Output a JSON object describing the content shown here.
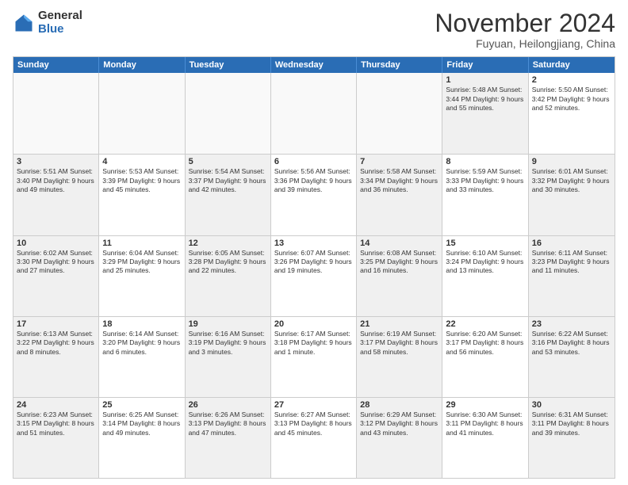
{
  "logo": {
    "general": "General",
    "blue": "Blue"
  },
  "title": {
    "month": "November 2024",
    "location": "Fuyuan, Heilongjiang, China"
  },
  "header_days": [
    "Sunday",
    "Monday",
    "Tuesday",
    "Wednesday",
    "Thursday",
    "Friday",
    "Saturday"
  ],
  "weeks": [
    [
      {
        "day": "",
        "info": "",
        "empty": true
      },
      {
        "day": "",
        "info": "",
        "empty": true
      },
      {
        "day": "",
        "info": "",
        "empty": true
      },
      {
        "day": "",
        "info": "",
        "empty": true
      },
      {
        "day": "",
        "info": "",
        "empty": true
      },
      {
        "day": "1",
        "info": "Sunrise: 5:48 AM\nSunset: 3:44 PM\nDaylight: 9 hours\nand 55 minutes.",
        "shaded": true
      },
      {
        "day": "2",
        "info": "Sunrise: 5:50 AM\nSunset: 3:42 PM\nDaylight: 9 hours\nand 52 minutes.",
        "shaded": false
      }
    ],
    [
      {
        "day": "3",
        "info": "Sunrise: 5:51 AM\nSunset: 3:40 PM\nDaylight: 9 hours\nand 49 minutes.",
        "shaded": true
      },
      {
        "day": "4",
        "info": "Sunrise: 5:53 AM\nSunset: 3:39 PM\nDaylight: 9 hours\nand 45 minutes.",
        "shaded": false
      },
      {
        "day": "5",
        "info": "Sunrise: 5:54 AM\nSunset: 3:37 PM\nDaylight: 9 hours\nand 42 minutes.",
        "shaded": true
      },
      {
        "day": "6",
        "info": "Sunrise: 5:56 AM\nSunset: 3:36 PM\nDaylight: 9 hours\nand 39 minutes.",
        "shaded": false
      },
      {
        "day": "7",
        "info": "Sunrise: 5:58 AM\nSunset: 3:34 PM\nDaylight: 9 hours\nand 36 minutes.",
        "shaded": true
      },
      {
        "day": "8",
        "info": "Sunrise: 5:59 AM\nSunset: 3:33 PM\nDaylight: 9 hours\nand 33 minutes.",
        "shaded": false
      },
      {
        "day": "9",
        "info": "Sunrise: 6:01 AM\nSunset: 3:32 PM\nDaylight: 9 hours\nand 30 minutes.",
        "shaded": true
      }
    ],
    [
      {
        "day": "10",
        "info": "Sunrise: 6:02 AM\nSunset: 3:30 PM\nDaylight: 9 hours\nand 27 minutes.",
        "shaded": true
      },
      {
        "day": "11",
        "info": "Sunrise: 6:04 AM\nSunset: 3:29 PM\nDaylight: 9 hours\nand 25 minutes.",
        "shaded": false
      },
      {
        "day": "12",
        "info": "Sunrise: 6:05 AM\nSunset: 3:28 PM\nDaylight: 9 hours\nand 22 minutes.",
        "shaded": true
      },
      {
        "day": "13",
        "info": "Sunrise: 6:07 AM\nSunset: 3:26 PM\nDaylight: 9 hours\nand 19 minutes.",
        "shaded": false
      },
      {
        "day": "14",
        "info": "Sunrise: 6:08 AM\nSunset: 3:25 PM\nDaylight: 9 hours\nand 16 minutes.",
        "shaded": true
      },
      {
        "day": "15",
        "info": "Sunrise: 6:10 AM\nSunset: 3:24 PM\nDaylight: 9 hours\nand 13 minutes.",
        "shaded": false
      },
      {
        "day": "16",
        "info": "Sunrise: 6:11 AM\nSunset: 3:23 PM\nDaylight: 9 hours\nand 11 minutes.",
        "shaded": true
      }
    ],
    [
      {
        "day": "17",
        "info": "Sunrise: 6:13 AM\nSunset: 3:22 PM\nDaylight: 9 hours\nand 8 minutes.",
        "shaded": true
      },
      {
        "day": "18",
        "info": "Sunrise: 6:14 AM\nSunset: 3:20 PM\nDaylight: 9 hours\nand 6 minutes.",
        "shaded": false
      },
      {
        "day": "19",
        "info": "Sunrise: 6:16 AM\nSunset: 3:19 PM\nDaylight: 9 hours\nand 3 minutes.",
        "shaded": true
      },
      {
        "day": "20",
        "info": "Sunrise: 6:17 AM\nSunset: 3:18 PM\nDaylight: 9 hours\nand 1 minute.",
        "shaded": false
      },
      {
        "day": "21",
        "info": "Sunrise: 6:19 AM\nSunset: 3:17 PM\nDaylight: 8 hours\nand 58 minutes.",
        "shaded": true
      },
      {
        "day": "22",
        "info": "Sunrise: 6:20 AM\nSunset: 3:17 PM\nDaylight: 8 hours\nand 56 minutes.",
        "shaded": false
      },
      {
        "day": "23",
        "info": "Sunrise: 6:22 AM\nSunset: 3:16 PM\nDaylight: 8 hours\nand 53 minutes.",
        "shaded": true
      }
    ],
    [
      {
        "day": "24",
        "info": "Sunrise: 6:23 AM\nSunset: 3:15 PM\nDaylight: 8 hours\nand 51 minutes.",
        "shaded": true
      },
      {
        "day": "25",
        "info": "Sunrise: 6:25 AM\nSunset: 3:14 PM\nDaylight: 8 hours\nand 49 minutes.",
        "shaded": false
      },
      {
        "day": "26",
        "info": "Sunrise: 6:26 AM\nSunset: 3:13 PM\nDaylight: 8 hours\nand 47 minutes.",
        "shaded": true
      },
      {
        "day": "27",
        "info": "Sunrise: 6:27 AM\nSunset: 3:13 PM\nDaylight: 8 hours\nand 45 minutes.",
        "shaded": false
      },
      {
        "day": "28",
        "info": "Sunrise: 6:29 AM\nSunset: 3:12 PM\nDaylight: 8 hours\nand 43 minutes.",
        "shaded": true
      },
      {
        "day": "29",
        "info": "Sunrise: 6:30 AM\nSunset: 3:11 PM\nDaylight: 8 hours\nand 41 minutes.",
        "shaded": false
      },
      {
        "day": "30",
        "info": "Sunrise: 6:31 AM\nSunset: 3:11 PM\nDaylight: 8 hours\nand 39 minutes.",
        "shaded": true
      }
    ]
  ]
}
